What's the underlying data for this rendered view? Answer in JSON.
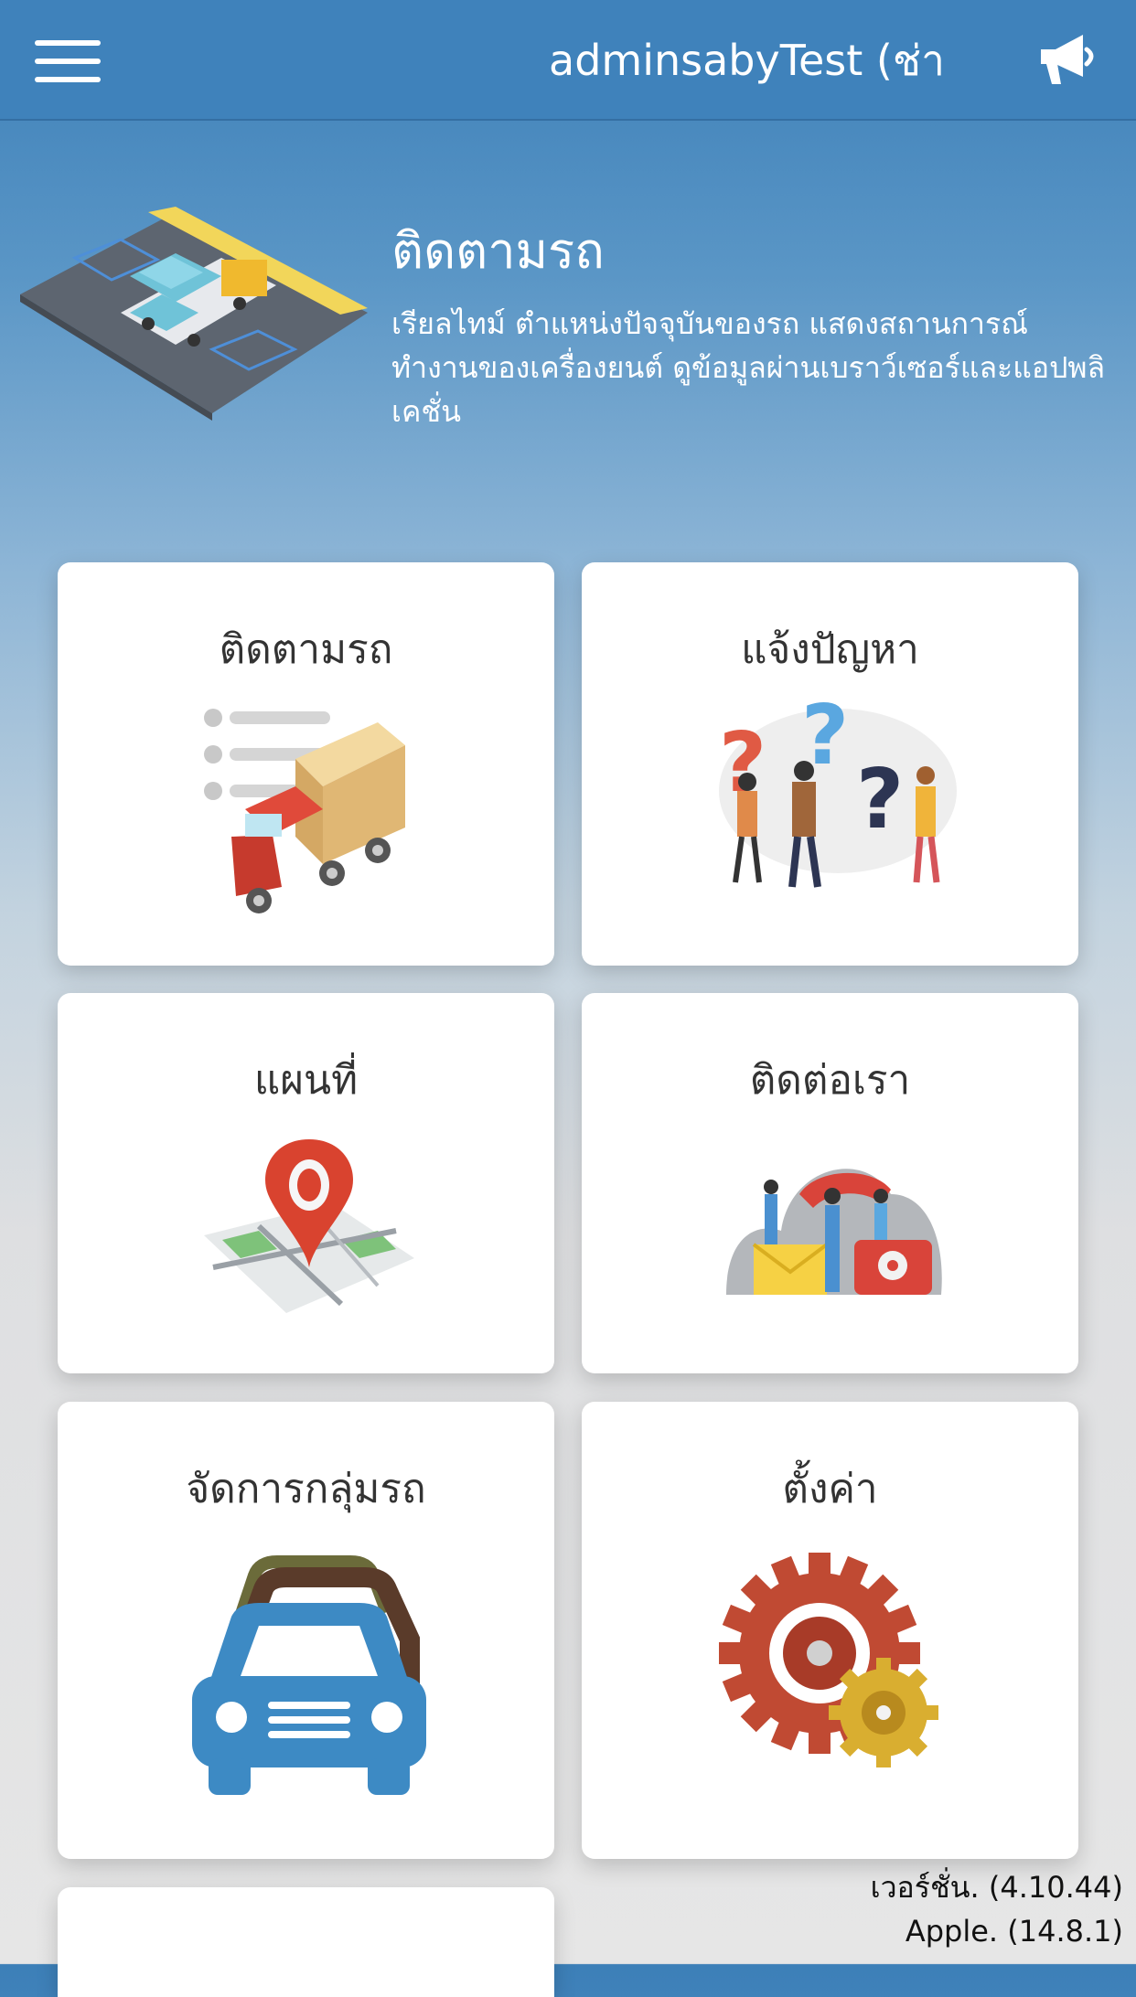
{
  "header": {
    "title": "adminsabyTest (ช่าง",
    "menu_icon": "hamburger-menu-icon",
    "announce_icon": "megaphone-icon",
    "bg_color": "#3f82bb"
  },
  "hero": {
    "title": "ติดตามรถ",
    "description": "เรียลไทม์ ตำแหน่งปัจจุบันของรถ แสดงสถานการณ์ ทำงานของเครื่องยนต์ ดูข้อมูลผ่านเบราว์เซอร์และแอปพลิเคชั่น"
  },
  "menu": {
    "items": [
      {
        "label": "ติดตามรถ",
        "icon": "truck-tracking-icon"
      },
      {
        "label": "แจ้งปัญหา",
        "icon": "question-people-icon"
      },
      {
        "label": "แผนที่",
        "icon": "map-pin-icon"
      },
      {
        "label": "ติดต่อเรา",
        "icon": "contact-phone-icon"
      },
      {
        "label": "จัดการกลุ่มรถ",
        "icon": "car-fleet-icon"
      },
      {
        "label": "ตั้งค่า",
        "icon": "gear-icon"
      }
    ]
  },
  "footer": {
    "version": "เวอร์ชั่น. (4.10.44)",
    "platform": "Apple. (14.8.1)"
  }
}
